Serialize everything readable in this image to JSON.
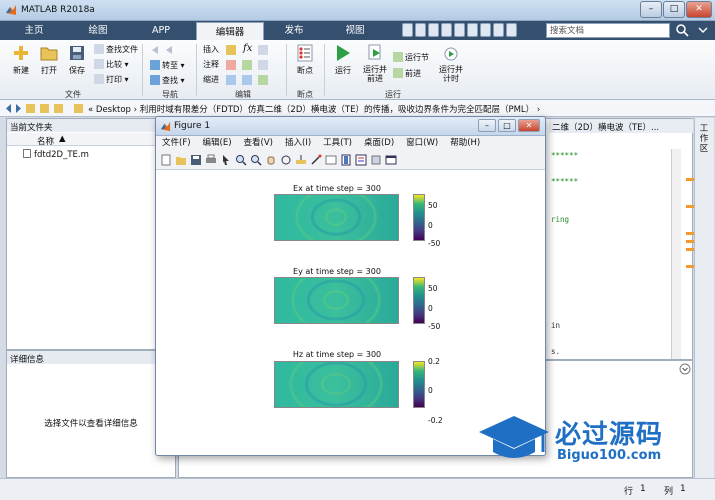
{
  "window": {
    "title": "MATLAB R2018a",
    "minimize": "–",
    "maximize": "□",
    "close": "✕"
  },
  "tabs": [
    {
      "label": "主页",
      "active": false
    },
    {
      "label": "绘图",
      "active": false
    },
    {
      "label": "APP",
      "active": false
    },
    {
      "label": "编辑器",
      "active": true
    },
    {
      "label": "发布",
      "active": false
    },
    {
      "label": "视图",
      "active": false
    }
  ],
  "search": {
    "placeholder": "搜索文档"
  },
  "ribbon": {
    "file_group": "文件",
    "new": "新建",
    "open": "打开",
    "save": "保存",
    "find_file": "查找文件",
    "compare": "比较",
    "print": "打印",
    "nav_group": "导航",
    "goto": "转至",
    "find": "查找",
    "edit_group": "编辑",
    "insert": "插入",
    "comment": "注释",
    "indent": "缩进",
    "fx": "fx",
    "breakpoint_group": "断点",
    "breakpoint": "断点",
    "run_group": "运行",
    "run": "运行",
    "run_advance": "运行并前进",
    "run_section": "运行节",
    "advance": "前进",
    "run_time": "运行并计时"
  },
  "address": {
    "path": "«  Desktop  ›  利用时域有限差分（FDTD）仿真二维（2D）横电波（TE）的传播，吸收边界条件为完全匹配层（PML）  ›"
  },
  "left_panel": {
    "title": "当前文件夹",
    "col_name": "名称",
    "files": [
      "fdtd2D_TE.m"
    ]
  },
  "details_panel": {
    "title": "详细信息",
    "message": "选择文件以查看详细信息"
  },
  "editor": {
    "tab_label": "二维（2D）横电波（TE）...",
    "code_lines": [
      "******",
      "******",
      "ring",
      "in",
      "s."
    ]
  },
  "right_strip": {
    "label": "工作区"
  },
  "status": {
    "row_label": "行",
    "row": "1",
    "col_label": "列",
    "col": "1"
  },
  "figure": {
    "title": "Figure 1",
    "menu": [
      "文件(F)",
      "编辑(E)",
      "查看(V)",
      "插入(I)",
      "工具(T)",
      "桌面(D)",
      "窗口(W)",
      "帮助(H)"
    ],
    "plots": [
      {
        "title": "Ex at time step = 300",
        "cbar_ticks": [
          "50",
          "0",
          "-50"
        ]
      },
      {
        "title": "Ey at time step = 300",
        "cbar_ticks": [
          "50",
          "0",
          "-50"
        ]
      },
      {
        "title": "Hz at time step = 300",
        "cbar_ticks": [
          "0.2",
          "0",
          "-0.2"
        ]
      }
    ]
  },
  "watermark": {
    "name": "必过源码",
    "url": "Biguo100.com"
  }
}
